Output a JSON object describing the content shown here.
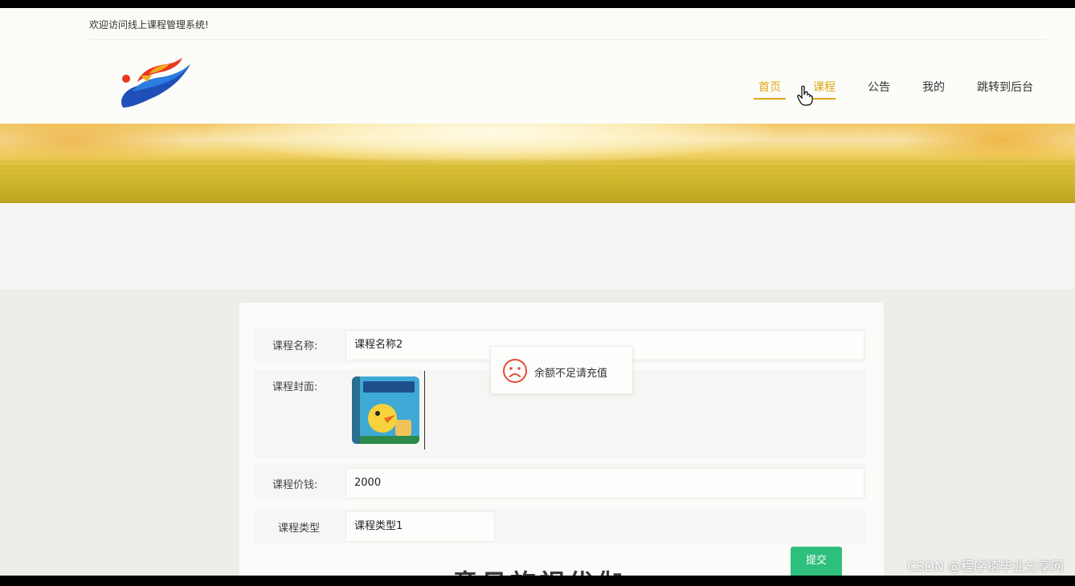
{
  "welcome": "欢迎访问线上课程管理系统!",
  "nav": {
    "items": [
      "首页",
      "课程",
      "公告",
      "我的",
      "跳转到后台"
    ]
  },
  "form": {
    "name_label": "课程名称:",
    "name_value": "课程名称2",
    "cover_label": "课程封面:",
    "price_label": "课程价钱:",
    "price_value": "2000",
    "type_label": "课程类型",
    "type_value": "课程类型1",
    "submit_label": "提交"
  },
  "toast": {
    "message": "余额不足请充值",
    "icon": "sad-face-icon",
    "color": "#e74c3c"
  },
  "bottom_title": "意见旅视优伽",
  "watermark": "CSDN @程序猿毕业分享网",
  "colors": {
    "accent": "#e0a818",
    "submit": "#2fbf7d"
  }
}
